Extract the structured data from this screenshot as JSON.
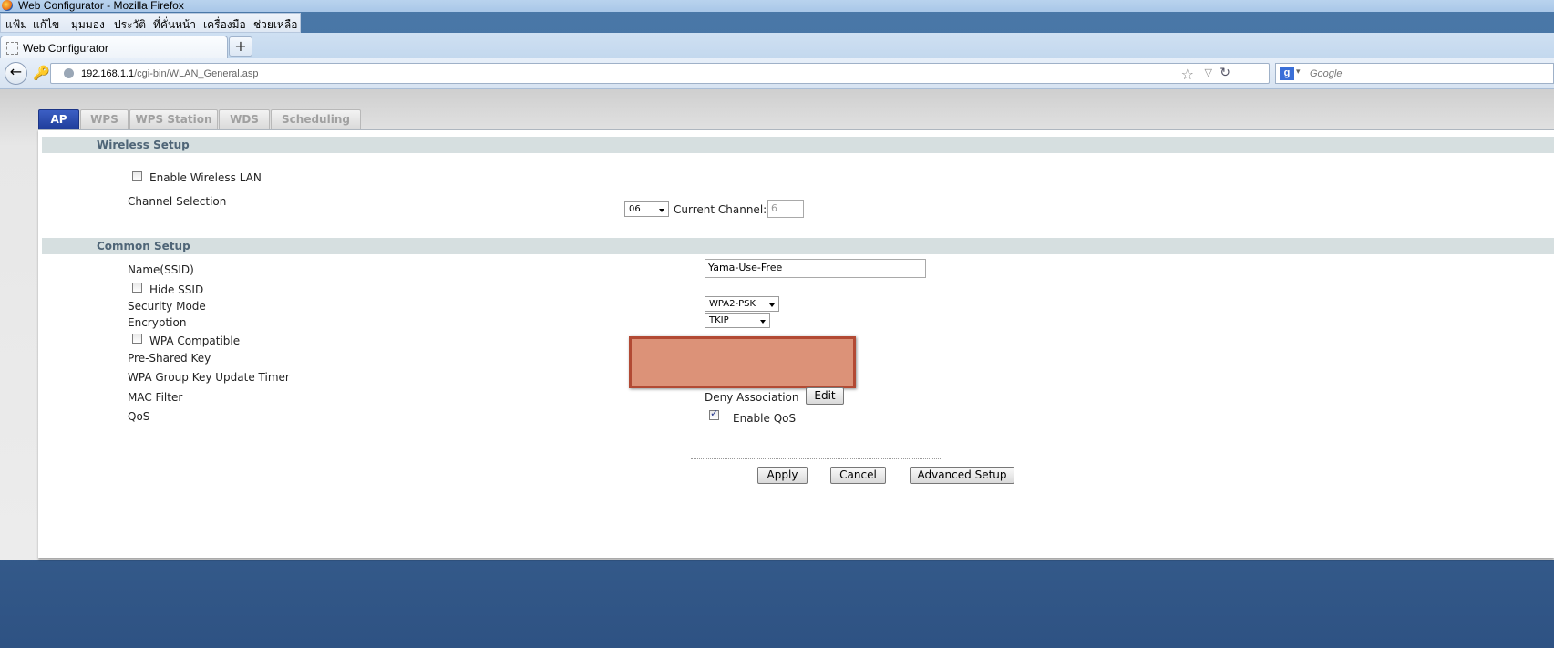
{
  "window": {
    "title": "Web Configurator - Mozilla Firefox"
  },
  "menu": [
    "แฟ้ม",
    "แก้ไข",
    "มุมมอง",
    "ประวัติ",
    "ที่คั่นหน้า",
    "เครื่องมือ",
    "ช่วยเหลือ"
  ],
  "browser_tab": {
    "title": "Web Configurator",
    "new_tab": "+"
  },
  "url": {
    "host": "192.168.1.1",
    "path": "/cgi-bin/WLAN_General.asp"
  },
  "search": {
    "placeholder": "Google",
    "engine_icon": "g"
  },
  "subtabs": [
    "AP",
    "WPS",
    "WPS Station",
    "WDS",
    "Scheduling"
  ],
  "active_subtab": "AP",
  "wireless_setup": {
    "heading": "Wireless Setup",
    "enable_wlan_label": "Enable Wireless LAN",
    "enable_wlan_checked": false,
    "channel_label": "Channel Selection",
    "channel_value": "06",
    "current_channel_label": "Current Channel:",
    "current_channel_value": "6"
  },
  "common_setup": {
    "heading": "Common Setup",
    "ssid_label": "Name(SSID)",
    "ssid_value": "Yama-Use-Free",
    "hide_ssid_label": "Hide SSID",
    "hide_ssid_checked": false,
    "security_mode_label": "Security Mode",
    "security_mode_value": "WPA2-PSK",
    "encryption_label": "Encryption",
    "encryption_value": "TKIP",
    "wpa_compatible_label": "WPA Compatible",
    "wpa_compatible_checked": false,
    "psk_label": "Pre-Shared Key",
    "group_key_label": "WPA Group Key Update Timer",
    "mac_filter_label": "MAC Filter",
    "mac_filter_value": "Deny Association",
    "mac_filter_button": "Edit",
    "qos_label": "QoS",
    "qos_enable_label": "Enable QoS",
    "qos_checked": true
  },
  "actions": {
    "apply": "Apply",
    "cancel": "Cancel",
    "advanced": "Advanced Setup"
  },
  "colors": {
    "active_tab": "#2a4ab0",
    "section_bg": "#d6dfe0",
    "redaction": "#dc9278"
  }
}
